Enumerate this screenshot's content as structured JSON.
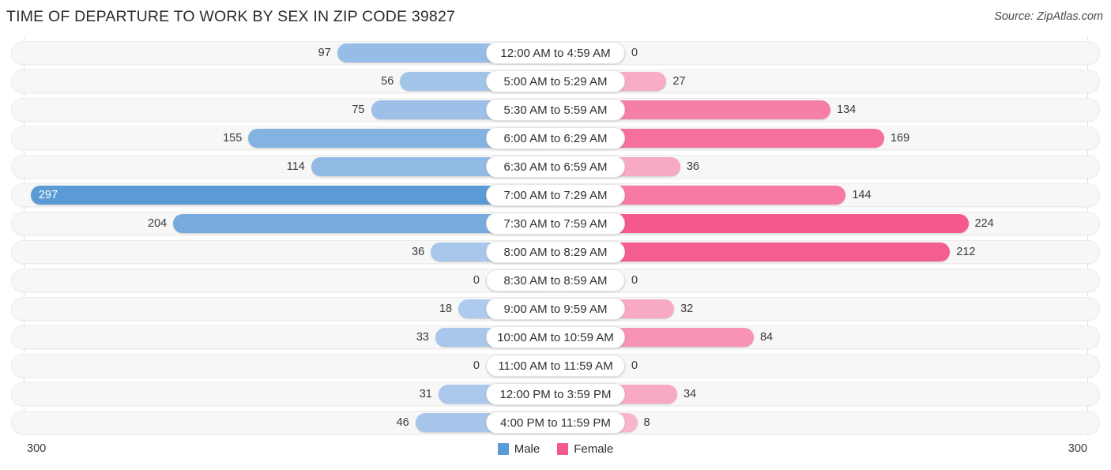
{
  "header": {
    "title": "TIME OF DEPARTURE TO WORK BY SEX IN ZIP CODE 39827",
    "source": "Source: ZipAtlas.com"
  },
  "axis": {
    "min_label": "300",
    "max_label": "300"
  },
  "legend": {
    "items": [
      {
        "label": "Male",
        "color": "#5b9bd5"
      },
      {
        "label": "Female",
        "color": "#f4588f"
      }
    ]
  },
  "colors": {
    "male_dark": "#5b9bd5",
    "male_light": "#b3cdee",
    "female_dark": "#f4588f",
    "female_light": "#f9b8cd",
    "row_background": "#f7f7f7",
    "gridline": "#e2e2e2"
  },
  "chart_data": {
    "type": "bar",
    "title": "TIME OF DEPARTURE TO WORK BY SEX IN ZIP CODE 39827",
    "subtitle": "",
    "xlabel": "",
    "ylabel": "",
    "orientation": "horizontal-diverging",
    "grid": true,
    "legend_position": "bottom-center",
    "axis_max": 300,
    "xlim": [
      -300,
      300
    ],
    "categories": [
      "12:00 AM to 4:59 AM",
      "5:00 AM to 5:29 AM",
      "5:30 AM to 5:59 AM",
      "6:00 AM to 6:29 AM",
      "6:30 AM to 6:59 AM",
      "7:00 AM to 7:29 AM",
      "7:30 AM to 7:59 AM",
      "8:00 AM to 8:29 AM",
      "8:30 AM to 8:59 AM",
      "9:00 AM to 9:59 AM",
      "10:00 AM to 10:59 AM",
      "11:00 AM to 11:59 AM",
      "12:00 PM to 3:59 PM",
      "4:00 PM to 11:59 PM"
    ],
    "series": [
      {
        "name": "Male",
        "color": "#5b9bd5",
        "direction": "left",
        "values": [
          97,
          56,
          75,
          155,
          114,
          297,
          204,
          36,
          0,
          18,
          33,
          0,
          31,
          46
        ]
      },
      {
        "name": "Female",
        "color": "#f4588f",
        "direction": "right",
        "values": [
          0,
          27,
          134,
          169,
          36,
          144,
          224,
          212,
          0,
          32,
          84,
          0,
          34,
          8
        ]
      }
    ]
  }
}
